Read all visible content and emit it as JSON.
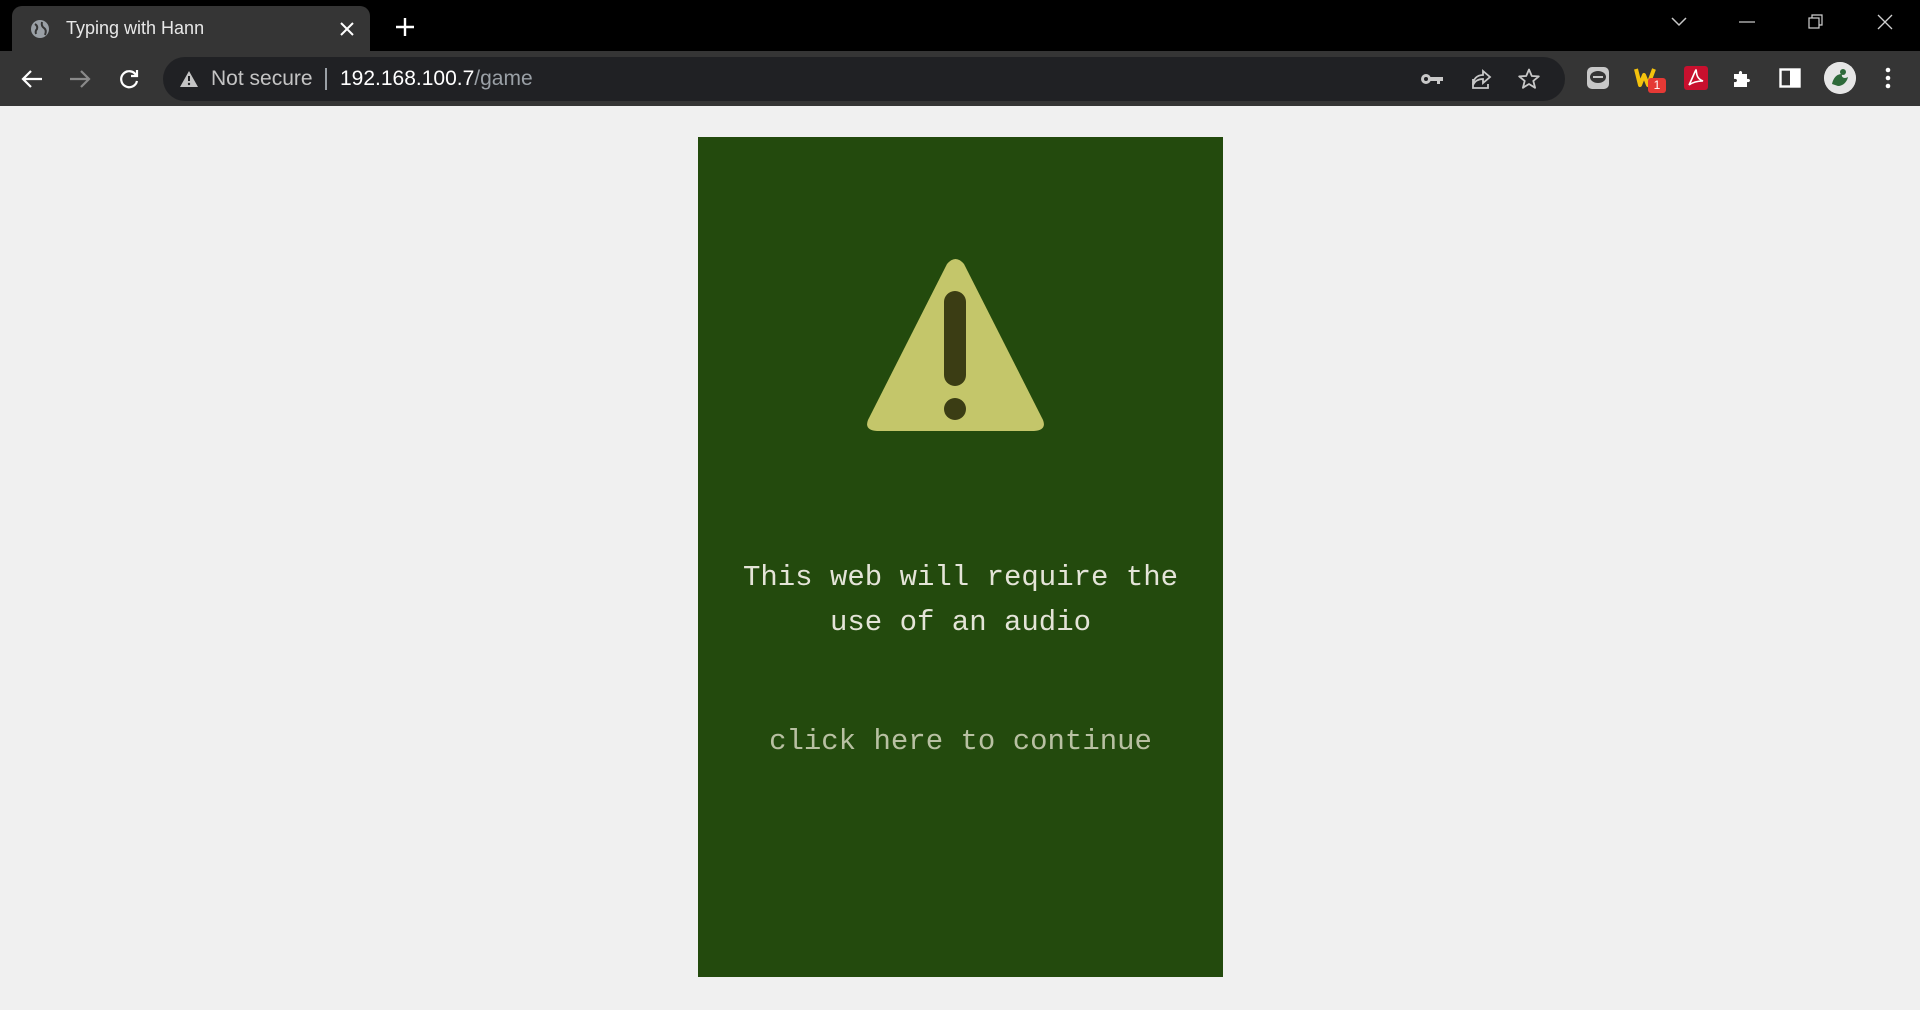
{
  "browser": {
    "tab_title": "Typing with Hann",
    "security_label": "Not secure",
    "url_host": "192.168.100.7",
    "url_path": "/game",
    "extension_badge": "1"
  },
  "icons": {
    "tab_favicon": "globe-icon",
    "tab_close": "close-icon",
    "new_tab": "plus-icon",
    "tab_search": "chevron-down-icon",
    "back": "arrow-left-icon",
    "forward": "arrow-right-icon",
    "reload": "reload-icon",
    "security": "warning-triangle-icon",
    "password": "key-icon",
    "share": "share-icon",
    "bookmark": "star-icon",
    "extensions": "puzzle-icon",
    "side_panel": "side-panel-icon",
    "menu": "kebab-menu-icon",
    "page_warning": "warning-triangle-icon"
  },
  "colors": {
    "panel_background": "#234a0d",
    "warning_fill": "#c4c66a",
    "warning_mark": "#3b3d14",
    "notice_text": "#e4e4d8",
    "continue_text": "#b8c0a2",
    "page_background": "#f0f0f0"
  },
  "page": {
    "notice_line1": "This web will require the",
    "notice_line2": "use of an audio",
    "continue_label": "click here to continue"
  }
}
